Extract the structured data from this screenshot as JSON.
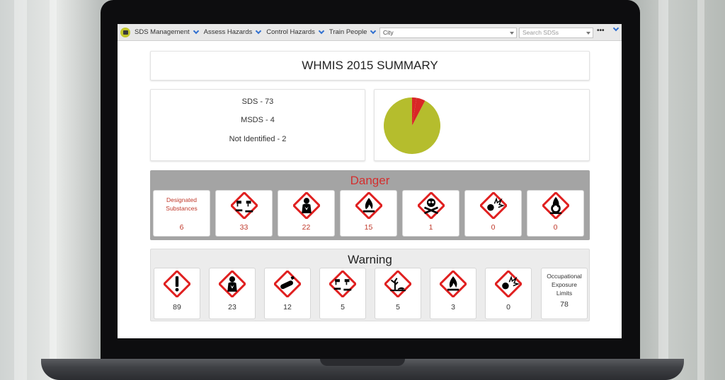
{
  "nav": {
    "menu": [
      {
        "label": "SDS Management"
      },
      {
        "label": "Assess Hazards"
      },
      {
        "label": "Control Hazards"
      },
      {
        "label": "Train People"
      }
    ],
    "location_select": "City",
    "search_placeholder": "Search SDSs",
    "more_label": "•••"
  },
  "summary": {
    "title": "WHMIS 2015 SUMMARY",
    "sds": "SDS - 73",
    "msds": "MSDS - 4",
    "not_identified": "Not Identified - 2"
  },
  "pie": {
    "slices": [
      {
        "label": "SDS",
        "value": 73,
        "color": "#b5bd2d"
      },
      {
        "label": "MSDS",
        "value": 4,
        "color": "#d92626"
      },
      {
        "label": "Not Identified",
        "value": 2,
        "color": "#d92626"
      }
    ]
  },
  "danger": {
    "title": "Danger",
    "text_card": {
      "label_line1": "Designated",
      "label_line2": "Substances",
      "count": "6"
    },
    "cards": [
      {
        "icon": "corrosion-icon",
        "count": "33"
      },
      {
        "icon": "health-hazard-icon",
        "count": "22"
      },
      {
        "icon": "flame-icon",
        "count": "15"
      },
      {
        "icon": "skull-crossbones-icon",
        "count": "1"
      },
      {
        "icon": "exploding-bomb-icon",
        "count": "0"
      },
      {
        "icon": "flame-over-circle-icon",
        "count": "0"
      }
    ]
  },
  "warning": {
    "title": "Warning",
    "cards": [
      {
        "icon": "exclamation-icon",
        "count": "89"
      },
      {
        "icon": "health-hazard-icon",
        "count": "23"
      },
      {
        "icon": "gas-cylinder-icon",
        "count": "12"
      },
      {
        "icon": "corrosion-icon",
        "count": "5"
      },
      {
        "icon": "environment-icon",
        "count": "5"
      },
      {
        "icon": "flame-icon",
        "count": "3"
      },
      {
        "icon": "exploding-bomb-icon",
        "count": "0"
      }
    ],
    "text_card": {
      "label_line1": "Occupational",
      "label_line2": "Exposure",
      "label_line3": "Limits",
      "count": "78"
    }
  },
  "colors": {
    "danger": "#d32f2f",
    "pictogram_border": "#e02020",
    "nav_chevron": "#2f6fd0"
  }
}
